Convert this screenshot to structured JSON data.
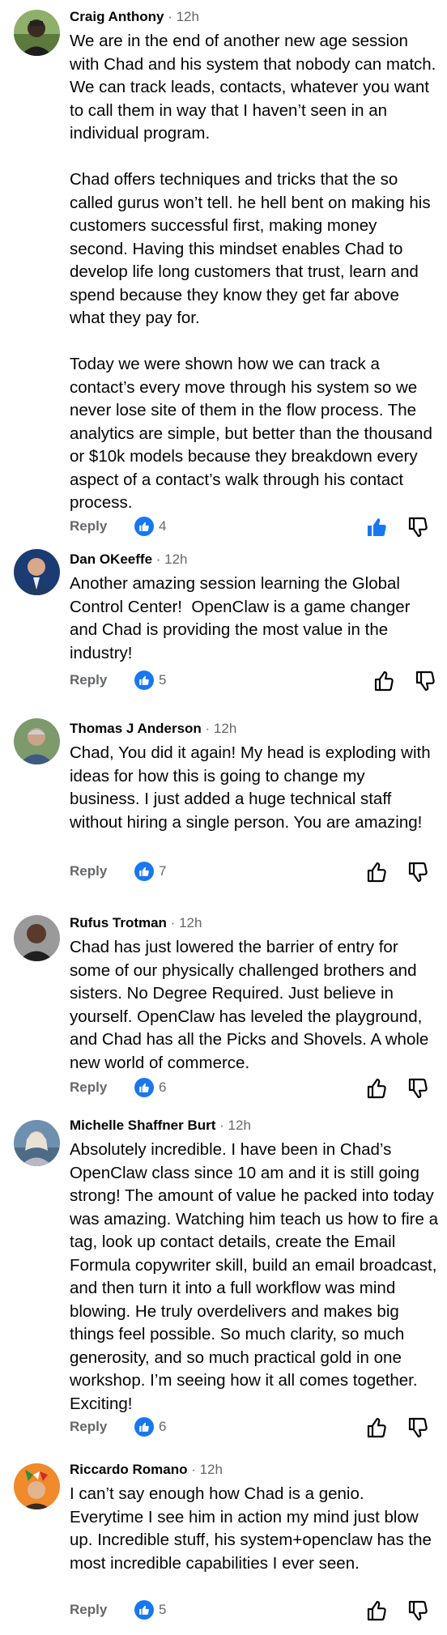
{
  "comments": [
    {
      "name": "Craig Anthony",
      "time": "12h",
      "text": "We are in the end of another new age session with Chad and his system that nobody can match. We can track leads, contacts, whatever you want to call them in way that I haven’t seen in an individual program.\n\nChad offers techniques and tricks that the so called gurus won’t tell. he hell bent on making his customers successful first, making money second. Having this mindset enables Chad to develop life long customers that trust, learn and spend because they know they get far above what they pay for.\n\nToday we were shown how we can track a contact’s every move through his system so we never lose site of them in the flow process. The analytics are simple, but better than the thousand or $10k models because they breakdown every aspect of a contact’s walk through his contact process.",
      "reply": "Reply",
      "likes": "4",
      "liked": true
    },
    {
      "name": "Dan OKeeffe",
      "time": "12h",
      "text": "Another amazing session learning the Global Control Center!  OpenClaw is a game changer and Chad is providing the most value in the industry!",
      "reply": "Reply",
      "likes": "5",
      "liked": false
    },
    {
      "name": "Thomas J Anderson",
      "time": "12h",
      "text": "Chad, You did it again! My head is exploding with ideas for how this is going to change my business. I just added a huge technical staff without hiring a single person. You are amazing!",
      "reply": "Reply",
      "likes": "7",
      "liked": false
    },
    {
      "name": "Rufus Trotman",
      "time": "12h",
      "text": "Chad has just lowered the barrier of entry for some of our physically challenged brothers and sisters. No Degree Required. Just believe in yourself. OpenClaw has leveled the playground, and Chad has all the Picks and Shovels. A whole new world of commerce.",
      "reply": "Reply",
      "likes": "6",
      "liked": false
    },
    {
      "name": "Michelle Shaffner Burt",
      "time": "12h",
      "text": "Absolutely incredible. I have been in Chad’s OpenClaw class since 10 am and it is still going strong! The amount of value he packed into today was amazing. Watching him teach us how to fire a tag, look up contact details, create the Email Formula copywriter skill, build an email broadcast, and then turn it into a full workflow was mind blowing. He truly overdelivers and makes big things feel possible. So much clarity, so much generosity, and so much practical gold in one workshop. I’m seeing how it all comes together. Exciting!",
      "reply": "Reply",
      "likes": "6",
      "liked": false
    },
    {
      "name": "Riccardo Romano",
      "time": "12h",
      "text": "I can’t say enough how Chad is a genio. Everytime I see him in action my mind just blow up. Incredible stuff, his system+openclaw has the most incredible capabilities I ever seen.",
      "reply": "Reply",
      "likes": "5",
      "liked": false
    }
  ],
  "icons": {
    "like_badge": "thumbs-up-icon",
    "like_action": "thumbs-up-icon",
    "dislike_action": "thumbs-down-icon"
  },
  "colors": {
    "accent": "#1877f2",
    "muted": "#65676b",
    "text": "#050505"
  }
}
